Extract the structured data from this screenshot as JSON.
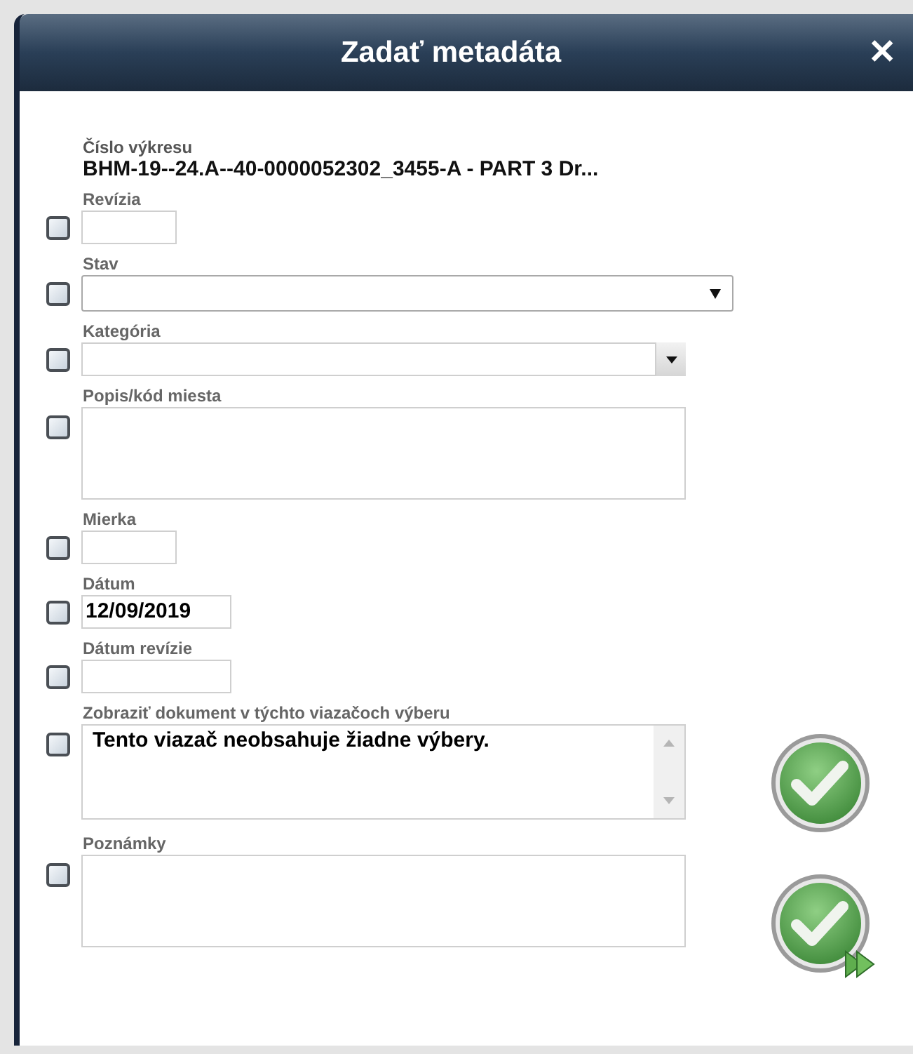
{
  "dialog": {
    "title": "Zadať metadáta",
    "close": "✕"
  },
  "drawing_number": {
    "label": "Číslo výkresu",
    "value": "BHM-19--24.A--40-0000052302_3455-A - PART 3 Dr..."
  },
  "fields": [
    {
      "label": "Revízia",
      "kind": "short",
      "checked": false
    },
    {
      "label": "Stav",
      "kind": "select",
      "checked": false
    },
    {
      "label": "Kategória",
      "kind": "combo",
      "checked": false
    },
    {
      "label": "Popis/kód miesta",
      "kind": "area",
      "checked": false
    },
    {
      "label": "Mierka",
      "kind": "short",
      "checked": false
    },
    {
      "label": "Dátum",
      "kind": "date",
      "value": "12/09/2019",
      "checked": false
    },
    {
      "label": "Dátum revízie",
      "kind": "date",
      "checked": false
    },
    {
      "label": "Zobraziť dokument v týchto viazačoch výberu",
      "kind": "list",
      "value": "Tento viazač neobsahuje žiadne výbery.",
      "checked": false
    },
    {
      "label": "Poznámky",
      "kind": "area",
      "checked": false
    }
  ]
}
